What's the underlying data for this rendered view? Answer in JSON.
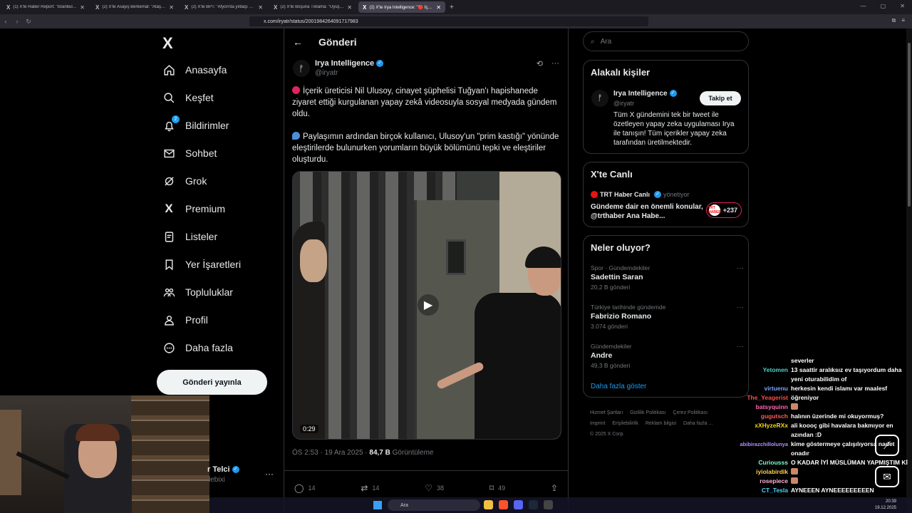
{
  "browser": {
    "tabs": [
      {
        "label": "(1) X'te Haber Report: \"İstanbul Başa...",
        "active": false
      },
      {
        "label": "(2) X'te Asayiş Berkemal: \"Ataşehir'd...",
        "active": false
      },
      {
        "label": "(2) X'te BPT: \"Afyon'da yılbaşı gecesi...",
        "active": false
      },
      {
        "label": "(2) X'te Boşuna Tıklama: \"Uyuşturucu...",
        "active": false
      },
      {
        "label": "(2) X'te Irya Intelligence: \"🔴 İçe...",
        "active": true
      }
    ],
    "url": "x.com/iryatr/status/2001984264091717983"
  },
  "nav": {
    "logo": "X",
    "items": [
      {
        "label": "Anasayfa",
        "icon": "home-icon"
      },
      {
        "label": "Keşfet",
        "icon": "search-icon"
      },
      {
        "label": "Bildirimler",
        "icon": "bell-icon",
        "badge": "2"
      },
      {
        "label": "Sohbet",
        "icon": "mail-icon"
      },
      {
        "label": "Grok",
        "icon": "grok-icon"
      },
      {
        "label": "Premium",
        "icon": "x-icon"
      },
      {
        "label": "Listeler",
        "icon": "list-icon"
      },
      {
        "label": "Yer İşaretleri",
        "icon": "bookmark-icon"
      },
      {
        "label": "Topluluklar",
        "icon": "communities-icon"
      },
      {
        "label": "Profil",
        "icon": "profile-icon"
      },
      {
        "label": "Daha fazla",
        "icon": "more-icon"
      }
    ],
    "post_button": "Gönderi yayınla",
    "profile_name": "r Telci",
    "profile_handle": "lebixi"
  },
  "post": {
    "header_title": "Gönderi",
    "author_name": "Irya Intelligence",
    "author_handle": "@iryatr",
    "paragraph1": "İçerik üreticisi Nil Ulusoy, cinayet şüphelisi Tuğyan'ı hapishanede ziyaret ettiği kurgulanan yapay zekâ videosuyla sosyal medyada gündem oldu.",
    "paragraph2": "Paylaşımın ardından birçok kullanıcı, Ulusoy'un \"prim kastığı\" yönünde eleştirilerde bulunurken yorumların büyük bölümünü tepki ve eleştiriler oluşturdu.",
    "video_duration": "0:29",
    "time": "ÖS 2:53 · 19 Ara 2025 · ",
    "views": "84,7 B",
    "views_label": " Görüntüleme",
    "stats": {
      "replies": "14",
      "reposts": "14",
      "likes": "38",
      "bookmarks": "49"
    }
  },
  "sidebar": {
    "search_placeholder": "Ara",
    "related_title": "Alakalı kişiler",
    "related": {
      "name": "Irya Intelligence",
      "handle": "@iryatr",
      "follow": "Takip et",
      "bio": "Tüm X gündemini tek bir tweet ile özetleyen yapay zeka uygulaması Irya ile tanışın! Tüm içerikler yapay zeka tarafından üretilmektedir."
    },
    "live_title": "X'te Canlı",
    "live": {
      "host": "TRT Haber Canlı",
      "status": "yönetiyor",
      "text": "Gündeme dair en önemli konular, @trthaber Ana Habe...",
      "count": "+237",
      "avatar_text": "TRT HABER"
    },
    "trends_title": "Neler oluyor?",
    "trends": [
      {
        "category": "Spor · Gündemdekiler",
        "name": "Sadettin Saran",
        "count": "20,2 B gönderi"
      },
      {
        "category": "Türkiye tarihinde gündemde",
        "name": "Fabrizio Romano",
        "count": "3.074 gönderi"
      },
      {
        "category": "Gündemdekiler",
        "name": "Andre",
        "count": "49,3 B gönderi"
      }
    ],
    "show_more": "Daha fazla göster",
    "footer": [
      "Hizmet Şartları",
      "Gizlilik Politikası",
      "Çerez Politikası",
      "Imprint",
      "Erişilebilirlik",
      "Reklam bilgisi",
      "Daha fazla ...",
      "© 2025 X Corp."
    ]
  },
  "chat": [
    {
      "user": "",
      "color": "#ffffff",
      "msg": "severler"
    },
    {
      "user": "Yetomen",
      "color": "#4fd1c5",
      "msg": "13 saattir aralıksız ev taşıyordum daha yeni oturabilidim of"
    },
    {
      "user": "virtuenu",
      "color": "#7aa2ff",
      "msg": "herkesin kendi islamı var maalesf"
    },
    {
      "user": "The_Yeagerist",
      "color": "#ff4d4d",
      "msg": "öğreniyor"
    },
    {
      "user": "batsyquinn",
      "color": "#ff69b4",
      "msg": ""
    },
    {
      "user": "gugutsch",
      "color": "#ff5a5a",
      "msg": "halının üzerinde mi okuyormuş?"
    },
    {
      "user": "xXHyzeRXx",
      "color": "#f5d90a",
      "msg": "ali koooç gibi havalara bakmıyor en azından :D"
    },
    {
      "user": "abibirazchillolunya",
      "color": "#b28dff",
      "msg": "kime göstermeye çalışılıyorsa nadet onadır"
    },
    {
      "user": "Curiousss",
      "color": "#7fffd4",
      "msg": "O KADAR İYİ MÜSLÜMAN YAPMIŞTIM Kİ"
    },
    {
      "user": "iyiolabirdik",
      "color": "#ffd24d",
      "msg": ""
    },
    {
      "user": "rosepiece",
      "color": "#ffb3d9",
      "msg": ""
    },
    {
      "user": "CT_Tesla",
      "color": "#4fd1ff",
      "msg": "AYNEEEN AYNEEEEEEEEEN"
    }
  ],
  "taskbar": {
    "search": "Ara",
    "time": "20:39",
    "date": "19.12.2025"
  }
}
